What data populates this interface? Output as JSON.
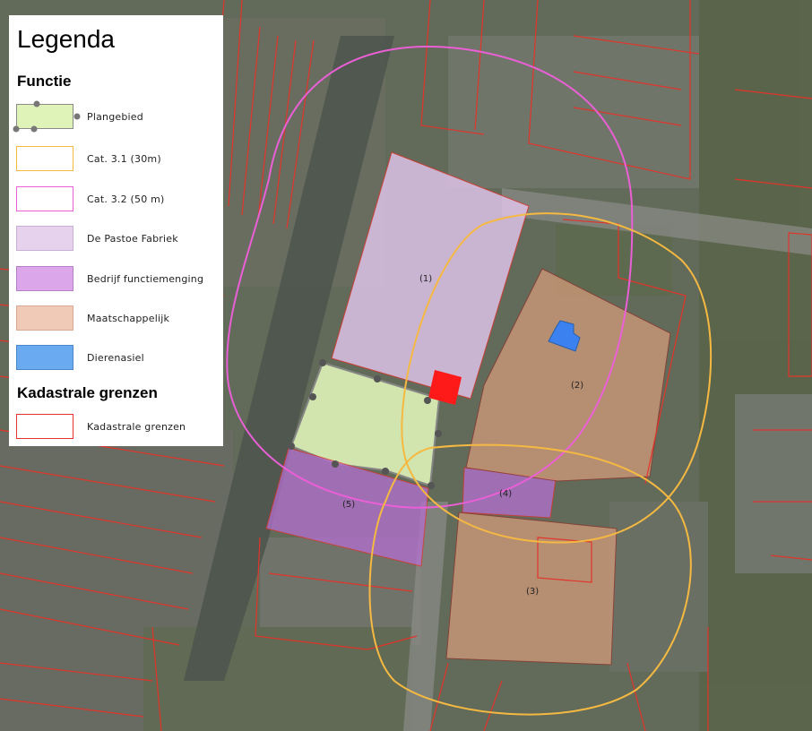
{
  "legend": {
    "title": "Legenda",
    "sections": {
      "functie": "Functie",
      "kadastraal": "Kadastrale grenzen"
    },
    "items": [
      {
        "label": "Plangebied",
        "color": "#dff3b8",
        "border": "#8a8a8a"
      },
      {
        "label": "Cat. 3.1 (30m)",
        "color": "#ffffff",
        "border": "#f5b942"
      },
      {
        "label": "Cat. 3.2 (50 m)",
        "color": "#ffffff",
        "border": "#ea5fd6"
      },
      {
        "label": "De Pastoe Fabriek",
        "color": "#e7d2ee",
        "border": "#c8b0d4"
      },
      {
        "label": "Bedrijf functiemenging",
        "color": "#dca6ea",
        "border": "#b680c8"
      },
      {
        "label": "Maatschappelijk",
        "color": "#f0c9b7",
        "border": "#d8a890"
      },
      {
        "label": "Dierenasiel",
        "color": "#6aaaf0",
        "border": "#4b86c8"
      },
      {
        "label": "Kadastrale grenzen",
        "color": "#ffffff",
        "border": "#e2342a"
      }
    ]
  },
  "map": {
    "parcel_labels": [
      "(1)",
      "(2)",
      "(3)",
      "(4)",
      "(5)"
    ],
    "colors": {
      "cadastral": "#e2342a",
      "plangebied": "#dff3b8",
      "pastoe": "#e3c7ef",
      "bedrijf": "#b56fd1",
      "maatschappelijk": "#c99778",
      "dierenasiel": "#3b82f0",
      "cat31": "#f5b942",
      "cat32": "#ea5fd6",
      "marker": "#ff1a1a"
    }
  }
}
